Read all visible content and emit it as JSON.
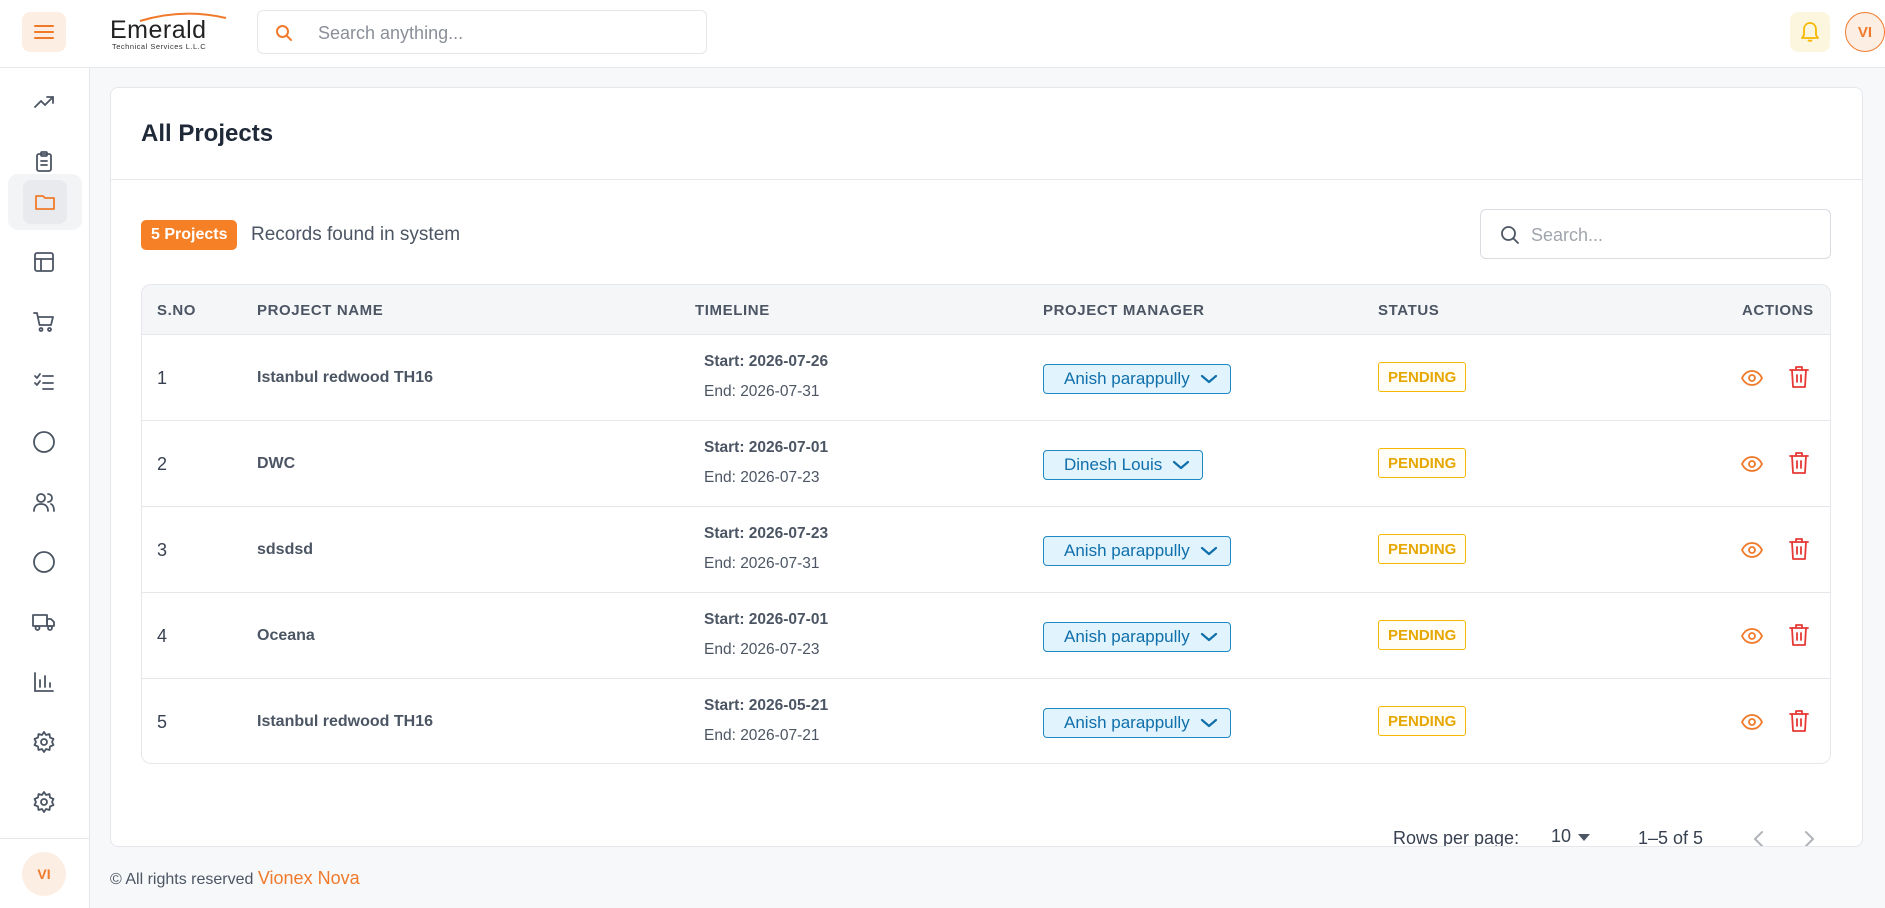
{
  "header": {
    "logo_main": "Emerald",
    "logo_sub": "Technical Services L.L.C",
    "search_placeholder": "Search anything...",
    "avatar_initials": "VI"
  },
  "sidebar": {
    "items": [
      {
        "icon": "trending-up-icon"
      },
      {
        "icon": "clipboard-list-icon"
      },
      {
        "icon": "folder-icon",
        "active": true
      },
      {
        "icon": "layout-icon"
      },
      {
        "icon": "cart-icon"
      },
      {
        "icon": "checklist-icon"
      },
      {
        "icon": "circle-icon"
      },
      {
        "icon": "users-icon"
      },
      {
        "icon": "circle-icon"
      },
      {
        "icon": "truck-icon"
      },
      {
        "icon": "bar-chart-icon"
      },
      {
        "icon": "gear-icon"
      },
      {
        "icon": "gear-icon"
      }
    ],
    "avatar_initials": "VI"
  },
  "main": {
    "title": "All Projects",
    "count_badge": "5 Projects",
    "records_text": "Records found in system",
    "search_placeholder": "Search...",
    "columns": [
      "S.NO",
      "PROJECT NAME",
      "TIMELINE",
      "PROJECT MANAGER",
      "STATUS",
      "ACTIONS"
    ],
    "rows": [
      {
        "sno": "1",
        "name": "Istanbul redwood TH16",
        "start": "Start: 2026-07-26",
        "end": "End: 2026-07-31",
        "manager": "Anish parappully",
        "status": "PENDING"
      },
      {
        "sno": "2",
        "name": "DWC",
        "start": "Start: 2026-07-01",
        "end": "End: 2026-07-23",
        "manager": "Dinesh Louis",
        "status": "PENDING"
      },
      {
        "sno": "3",
        "name": "sdsdsd",
        "start": "Start: 2026-07-23",
        "end": "End: 2026-07-31",
        "manager": "Anish parappully",
        "status": "PENDING"
      },
      {
        "sno": "4",
        "name": "Oceana",
        "start": "Start: 2026-07-01",
        "end": "End: 2026-07-23",
        "manager": "Anish parappully",
        "status": "PENDING"
      },
      {
        "sno": "5",
        "name": "Istanbul redwood TH16",
        "start": "Start: 2026-05-21",
        "end": "End: 2026-07-21",
        "manager": "Anish parappully",
        "status": "PENDING"
      }
    ],
    "pagination": {
      "rows_label": "Rows per page:",
      "rows_value": "10",
      "range": "1–5 of 5"
    }
  },
  "footer": {
    "text": "© All rights reserved",
    "brand": "Vionex Nova"
  },
  "colors": {
    "accent": "#f58025",
    "status_pending": "#e6a700",
    "manager_blue": "#1e88c7",
    "delete_red": "#e53935"
  }
}
